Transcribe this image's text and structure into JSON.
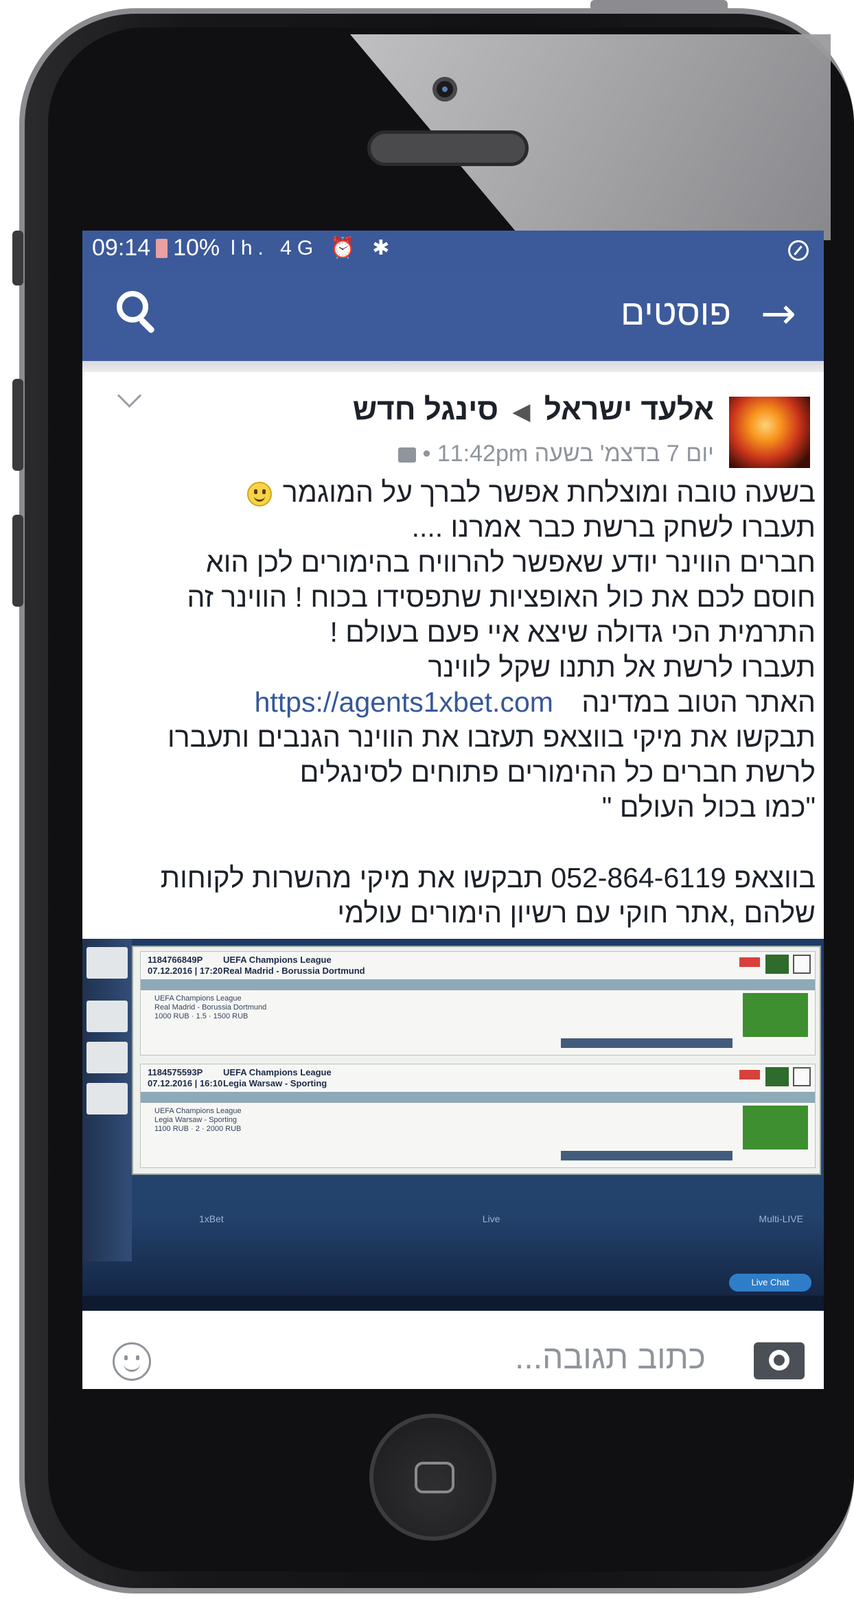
{
  "status_bar": {
    "time": "09:14",
    "battery": "10%",
    "icons": "lh. 4G ⏰ ✱"
  },
  "header": {
    "title": "פוסטים"
  },
  "post": {
    "author": "אלעד ישראל",
    "group": "סינגל חדש",
    "meta": "יום 7 בדצמ' בשעה 11:42pm •",
    "lines": [
      "בשעה טובה ומוצלחת אפשר לברך על המוגמר",
      "תעברו לשחק ברשת כבר אמרנו ....",
      "חברים הווינר יודע שאפשר להרוויח בהימורים לכן הוא",
      "חוסם לכם את כול האופציות שתפסידו בכוח ! הווינר זה",
      "התרמית הכי גדולה שיצא איי פעם בעולם !",
      "תעברו לרשת אל תתנו שקל לווינר",
      "האתר הטוב במדינה",
      "תבקשו את מיקי בווצאפ תעזבו את הווינר הגנבים ותעברו",
      "לרשת חברים כל ההימורים פתוחים לסינגלים",
      "\"כמו בכול העולם \"",
      "בווצאפ 052-864-6119 תבקשו את מיקי מהשרות לקוחות",
      "שלהם ,אתר חוקי עם רשיון הימורים עולמי"
    ],
    "link": "https://agents1xbet.com"
  },
  "photo": {
    "bet1": {
      "id": "1184766849P",
      "date": "07.12.2016 | 17:20",
      "league": "UEFA Champions League",
      "match": "Real Madrid - Borussia Dortmund",
      "odds": "1.5",
      "stake": "1000 RUB",
      "payout": "1500 RUB"
    },
    "bet2": {
      "id": "1184575593P",
      "date": "07.12.2016 | 16:10",
      "league": "UEFA Champions League",
      "match": "Legia Warsaw - Sporting",
      "odds": "2",
      "stake": "1100 RUB",
      "payout": "2000 RUB"
    },
    "footer": [
      "1xBet",
      "Live",
      "Multi-LIVE"
    ],
    "live_chat": "Live Chat"
  },
  "comment": {
    "placeholder": "כתוב תגובה..."
  }
}
